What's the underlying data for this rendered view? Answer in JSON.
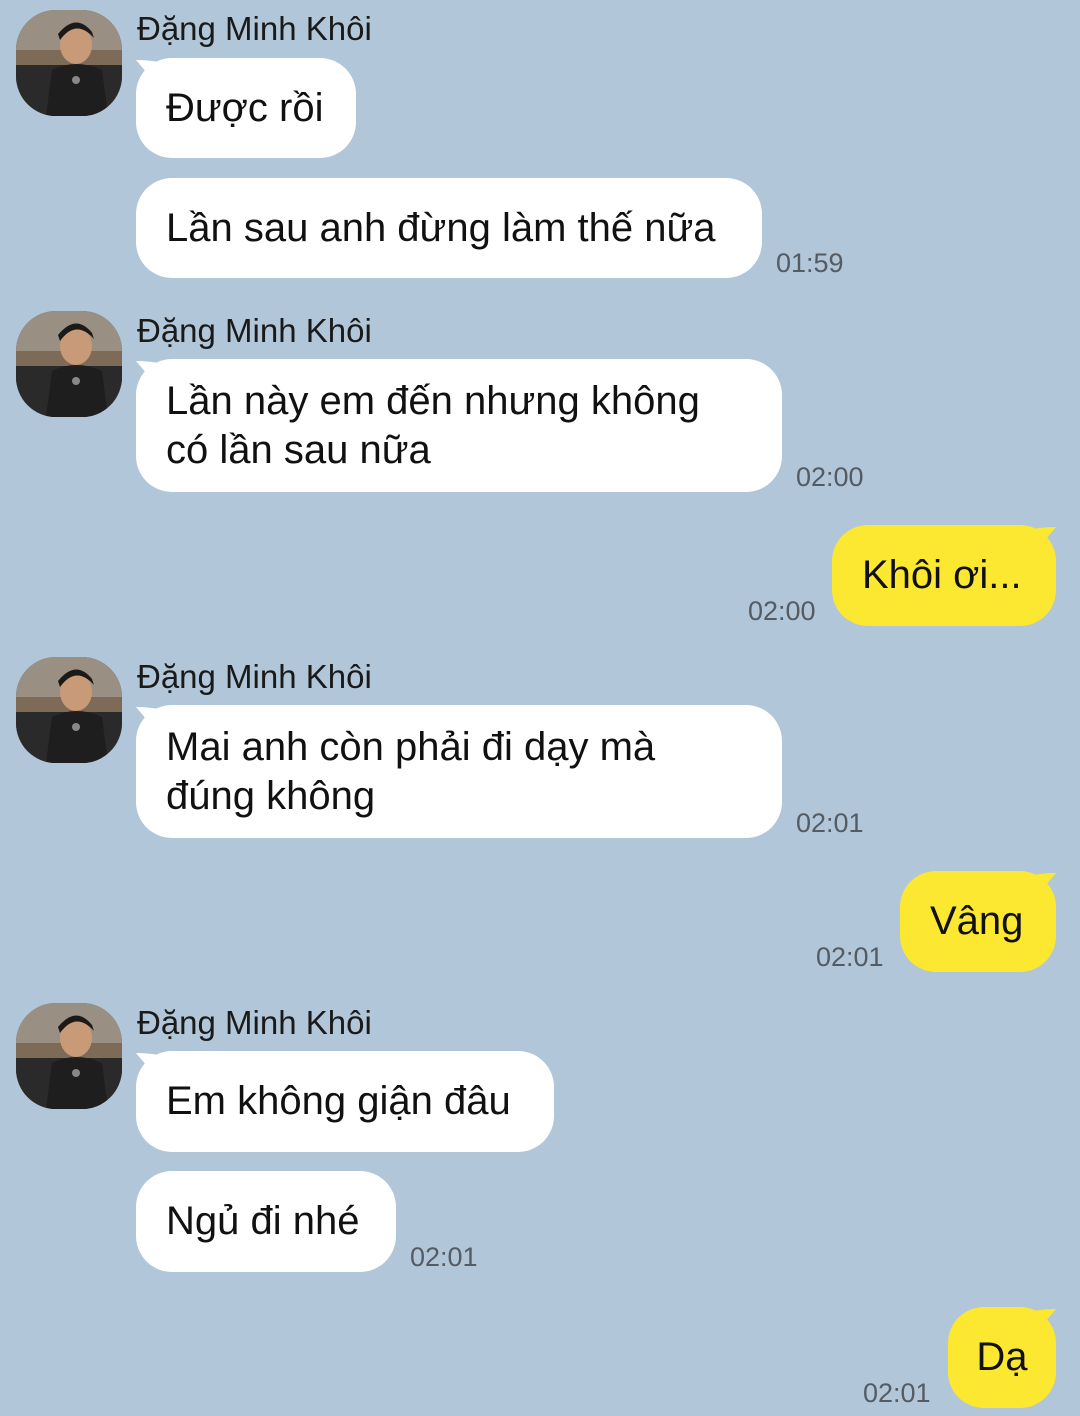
{
  "contact": {
    "name": "Đặng Minh Khôi"
  },
  "messages": [
    {
      "from": "them",
      "text": "Được rồi"
    },
    {
      "from": "them",
      "text": "Lần sau anh đừng làm thế nữa",
      "time": "01:59"
    },
    {
      "from": "them",
      "lines": [
        "Lần này em đến nhưng không",
        "có lần sau nữa"
      ],
      "time": "02:00"
    },
    {
      "from": "me",
      "text": "Khôi ơi...",
      "time": "02:00"
    },
    {
      "from": "them",
      "lines": [
        "Mai anh còn phải đi dạy mà",
        "đúng không"
      ],
      "time": "02:01"
    },
    {
      "from": "me",
      "text": "Vâng",
      "time": "02:01"
    },
    {
      "from": "them",
      "text": "Em không giận đâu"
    },
    {
      "from": "them",
      "text": "Ngủ đi nhé",
      "time": "02:01"
    },
    {
      "from": "me",
      "text": "Dạ",
      "time": "02:01"
    }
  ],
  "colors": {
    "background": "#b1c6d9",
    "incoming_bubble": "#ffffff",
    "outgoing_bubble": "#fde831"
  },
  "icons": {
    "avatar": "contact-avatar-photo"
  }
}
